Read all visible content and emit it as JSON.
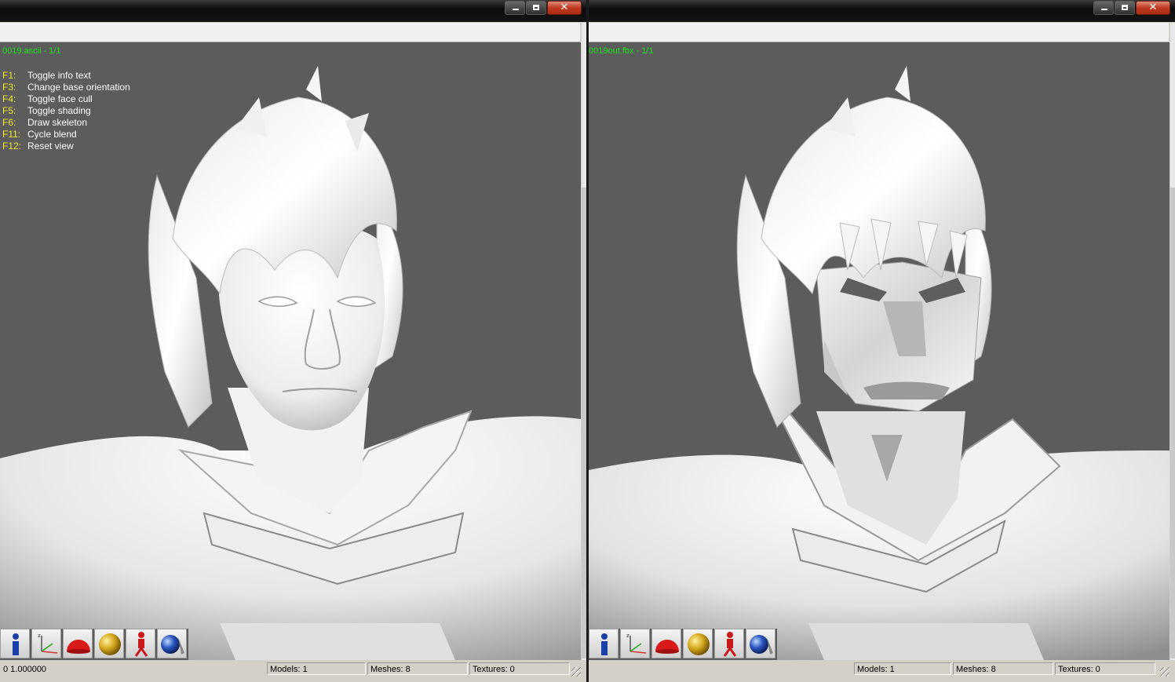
{
  "windows": [
    {
      "id": "left",
      "title_text": "0019.ascii - 1/1",
      "status": {
        "value_text": "0 1.000000",
        "models_label": "Models: 1",
        "meshes_label": "Meshes: 8",
        "textures_label": "Textures: 0"
      }
    },
    {
      "id": "right",
      "title_text": "0019out.fbx - 1/1",
      "status": {
        "models_label": "Models: 1",
        "meshes_label": "Meshes: 8",
        "textures_label": "Textures: 0"
      }
    }
  ],
  "help_lines": [
    {
      "key": "F1:",
      "action": "Toggle info text"
    },
    {
      "key": "F3:",
      "action": "Change base orientation"
    },
    {
      "key": "F4:",
      "action": "Toggle face cull"
    },
    {
      "key": "F5:",
      "action": "Toggle shading"
    },
    {
      "key": "F6:",
      "action": "Draw skeleton"
    },
    {
      "key": "F11:",
      "action": "Cycle blend"
    },
    {
      "key": "F12:",
      "action": "Reset view"
    }
  ],
  "toolbar_icons": [
    "info-icon",
    "axes-icon",
    "red-dome-icon",
    "gold-sphere-icon",
    "robot-skeleton-icon",
    "blue-sphere-icon"
  ],
  "colors": {
    "viewport_bg": "#5c5c5c",
    "title_text": "#16e616",
    "help_key": "#f2e830",
    "help_desc": "#ffffff",
    "close_button": "#c03a22"
  }
}
